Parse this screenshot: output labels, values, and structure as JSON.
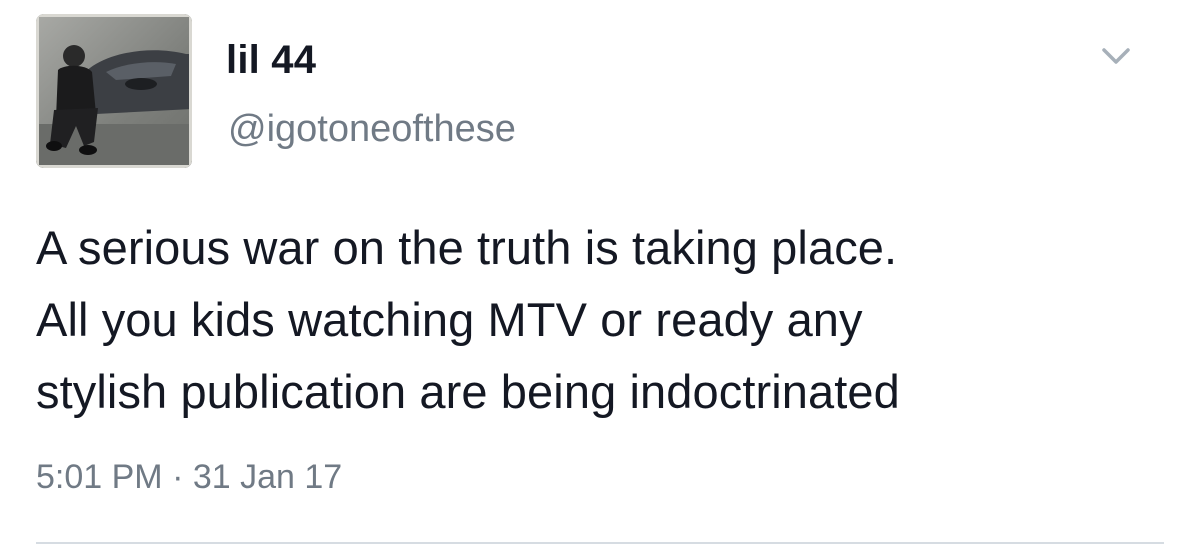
{
  "tweet": {
    "display_name": "lil 44",
    "handle": "@igotoneofthese",
    "text_lines": [
      "A serious war on the truth is taking place.",
      "All you kids watching MTV or ready any",
      "stylish publication are being indoctrinated"
    ],
    "timestamp": "5:01 PM · 31 Jan 17"
  },
  "icons": {
    "avatar": "profile-photo",
    "menu": "chevron-down-icon"
  },
  "colors": {
    "text": "#141823",
    "secondary_text": "#707a85",
    "divider": "#d6dce2"
  }
}
